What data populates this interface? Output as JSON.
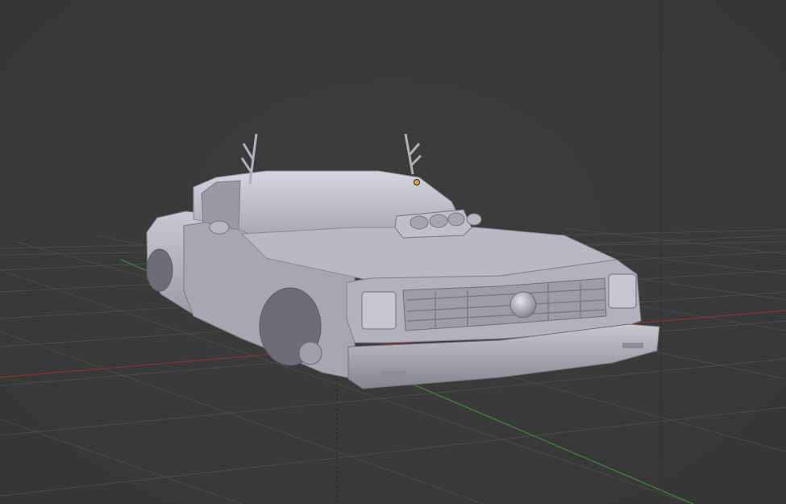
{
  "viewport": {
    "background_color": "#3a3a3a",
    "grid_color": "#4a4a4a",
    "x_axis_color": "#8c2f2f",
    "y_axis_color": "#3f8c3a",
    "origin_marker_color": "#e8a040"
  },
  "scene": {
    "object": "car-model",
    "shading": "solid-grey"
  }
}
